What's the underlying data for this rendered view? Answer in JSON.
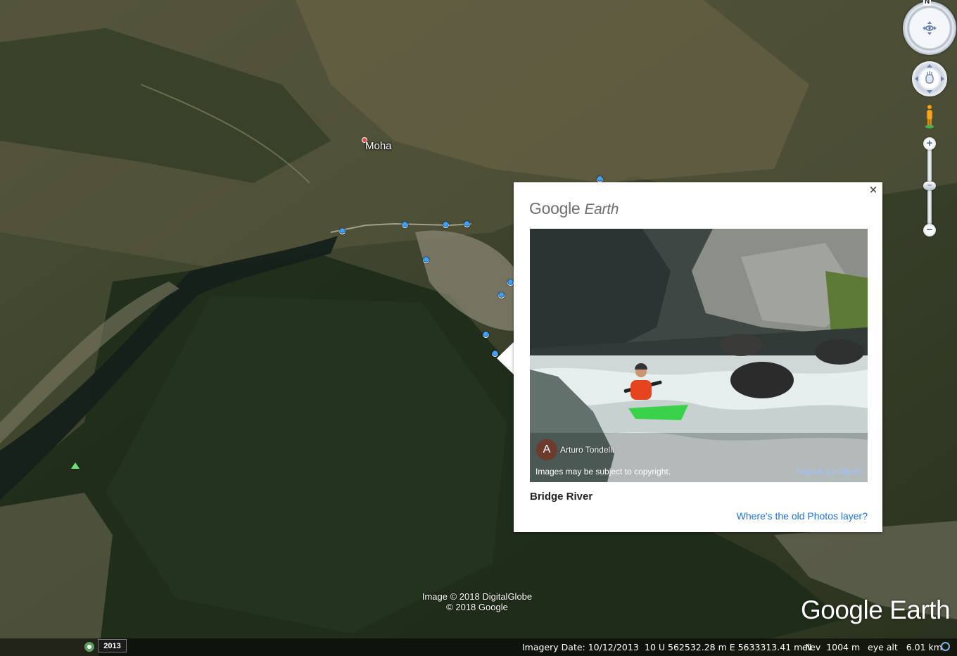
{
  "map": {
    "place_label": "Moha",
    "brand": "Google Earth",
    "attribution_line1": "Image © 2018 DigitalGlobe",
    "attribution_line2": "© 2018 Google"
  },
  "nav": {
    "north_label": "N",
    "zoom_in": "+",
    "zoom_out": "−",
    "zoom_thumb": "−"
  },
  "popup": {
    "logo_google": "Google",
    "logo_earth": "Earth",
    "close": "×",
    "author_initial": "A",
    "author_name": "Arturo Tondelli",
    "copyright_note": "Images may be subject to copyright.",
    "report_link": "Report a problem",
    "photo_title": "Bridge River",
    "old_photos_link": "Where's the old Photos layer?"
  },
  "status": {
    "year": "2013",
    "imagery_date": "Imagery Date: 10/12/2013",
    "coordinates": "10 U 562532.28 m E 5633313.41 m N",
    "elev": "elev  1004 m",
    "eye_alt": "eye alt   6.01 km"
  },
  "colors": {
    "link": "#1a73e8",
    "place_marker": "#e64a4a",
    "photo_marker": "#3ea2ff"
  }
}
